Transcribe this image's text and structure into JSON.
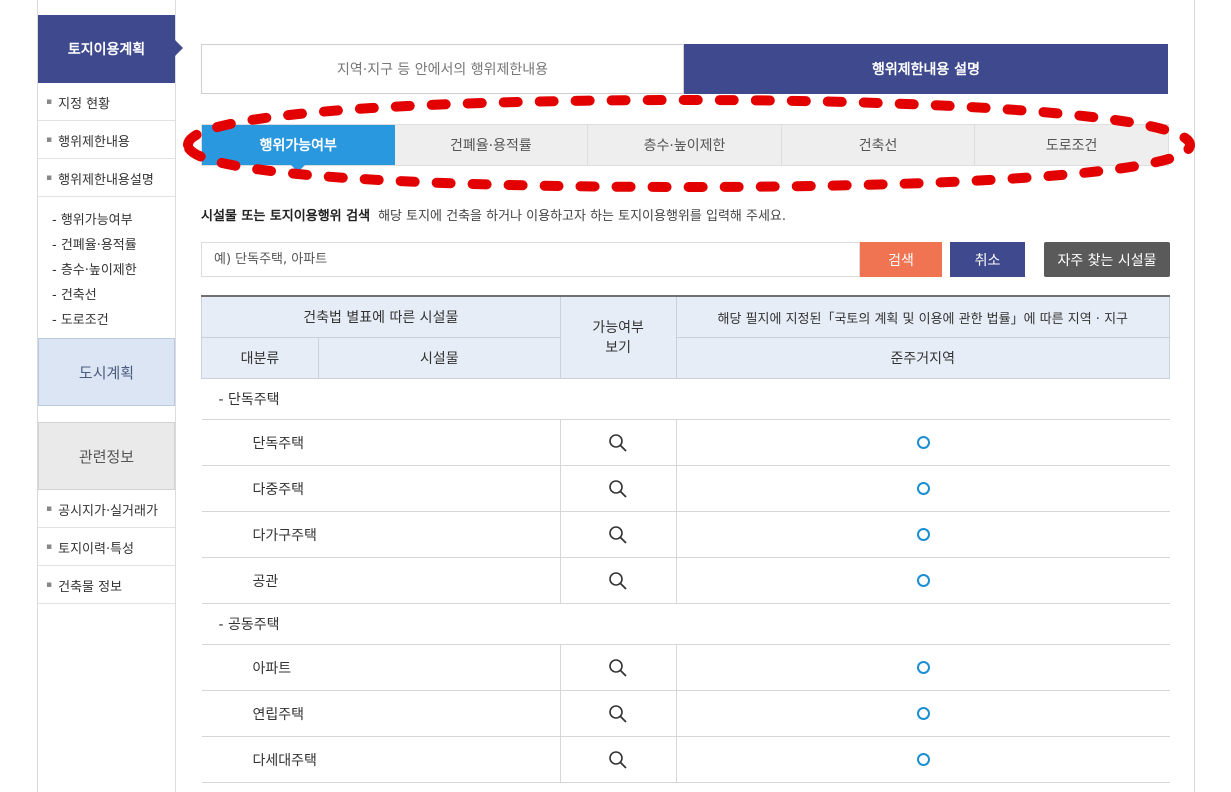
{
  "sidebar": {
    "heading": "토지이용계획",
    "items": [
      {
        "label": "지정 현황"
      },
      {
        "label": "행위제한내용"
      },
      {
        "label": "행위제한내용설명"
      }
    ],
    "sub_items": [
      "- 행위가능여부",
      "- 건폐율·용적률",
      "- 층수·높이제한",
      "- 건축선",
      "- 도로조건"
    ],
    "city_plan": "도시계획",
    "related_info": "관련정보",
    "related_items": [
      {
        "label": "공시지가·실거래가"
      },
      {
        "label": "토지이력·특성"
      },
      {
        "label": "건축물 정보"
      }
    ]
  },
  "top_tabs": [
    "지역·지구 등 안에서의 행위제한내용",
    "행위제한내용 설명"
  ],
  "sub_tabs": [
    "행위가능여부",
    "건폐율·용적률",
    "층수·높이제한",
    "건축선",
    "도로조건"
  ],
  "search": {
    "title": "시설물 또는 토지이용행위 검색",
    "description": "해당 토지에 건축을 하거나 이용하고자 하는 토지이용행위를 입력해 주세요.",
    "placeholder": "예) 단독주택, 아파트",
    "search_button": "검색",
    "cancel_button": "취소",
    "frequent_button": "자주 찾는 시설물"
  },
  "table": {
    "header_facility": "건축법 별표에 따른 시설물",
    "header_possible": "가능여부\n보기",
    "header_zone": "해당 필지에 지정된「국토의 계획 및 이용에 관한 법률」에 따른 지역 · 지구",
    "sub_category": "대분류",
    "sub_facility": "시설물",
    "sub_zone": "준주거지역",
    "groups": [
      {
        "label": "- 단독주택",
        "rows": [
          "단독주택",
          "다중주택",
          "다가구주택",
          "공관"
        ]
      },
      {
        "label": "- 공동주택",
        "rows": [
          "아파트",
          "연립주택",
          "다세대주택"
        ]
      }
    ]
  },
  "colors": {
    "navy": "#3f4a8e",
    "active_tab": "#2a98df",
    "search_btn": "#f07352",
    "annotation": "#e30000"
  },
  "icons": {
    "view": "magnifier-icon",
    "status": "circle-o-icon"
  }
}
